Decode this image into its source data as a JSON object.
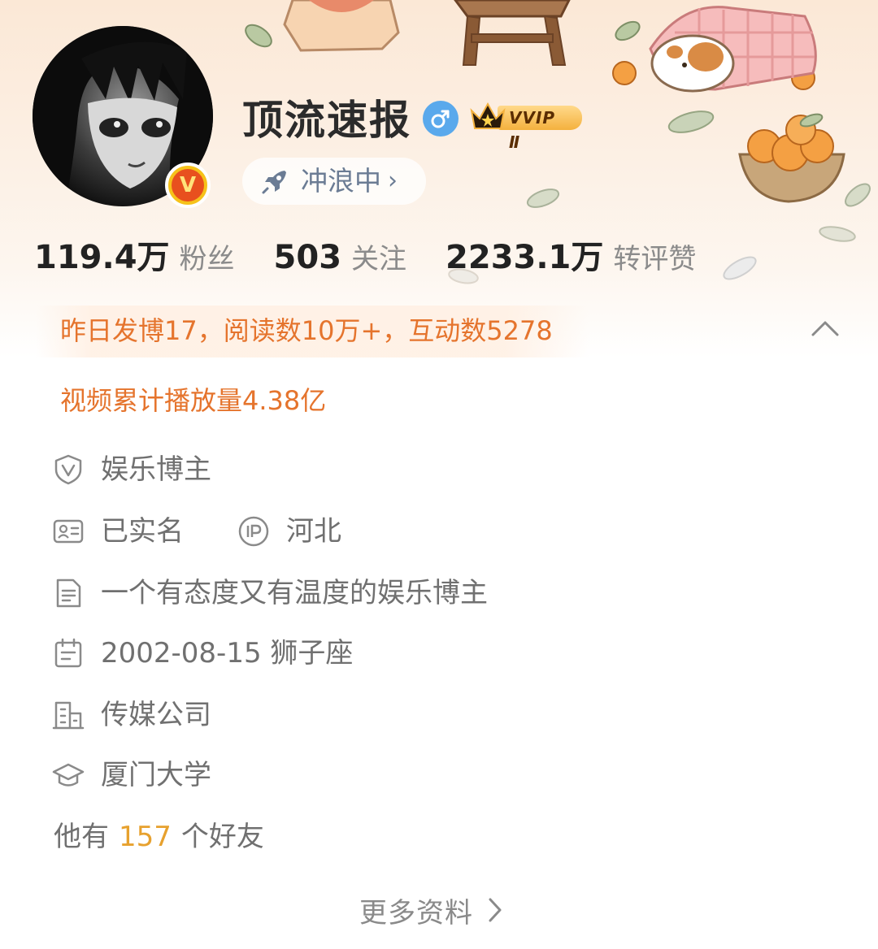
{
  "profile": {
    "name": "顶流速报",
    "gender_icon": "male-icon",
    "vip_badge": "VVIP Ⅱ",
    "verify_badge": "V",
    "status_pill": {
      "label": "冲浪中",
      "chevron": "›",
      "icon": "rocket-icon"
    }
  },
  "stats": [
    {
      "value": "119.4万",
      "label": "粉丝"
    },
    {
      "value": "503",
      "label": "关注"
    },
    {
      "value": "2233.1万",
      "label": "转评赞"
    }
  ],
  "highlights": {
    "line1": "昨日发博17，阅读数10万+，互动数5278",
    "line2": "视频累计播放量4.38亿"
  },
  "info": {
    "category": {
      "icon": "shield-v-icon",
      "text": "娱乐博主"
    },
    "real_name": {
      "icon": "id-card-icon",
      "text": "已实名"
    },
    "ip_location": {
      "icon": "ip-icon",
      "text": "河北"
    },
    "bio": {
      "icon": "document-icon",
      "text": "一个有态度又有温度的娱乐博主"
    },
    "birthday": {
      "icon": "calendar-icon",
      "text": "2002-08-15 狮子座"
    },
    "company": {
      "icon": "building-icon",
      "text": "传媒公司"
    },
    "school": {
      "icon": "graduation-cap-icon",
      "text": "厦门大学"
    }
  },
  "friends": {
    "prefix": "他有",
    "count": "157",
    "suffix": "个好友"
  },
  "more": {
    "label": "更多资料"
  },
  "colors": {
    "accent_orange": "#e5742d",
    "friend_count": "#e7a12e",
    "text_gray": "#707070",
    "name_dark": "#2b2b2b",
    "gender_blue": "#5aa9ec"
  }
}
